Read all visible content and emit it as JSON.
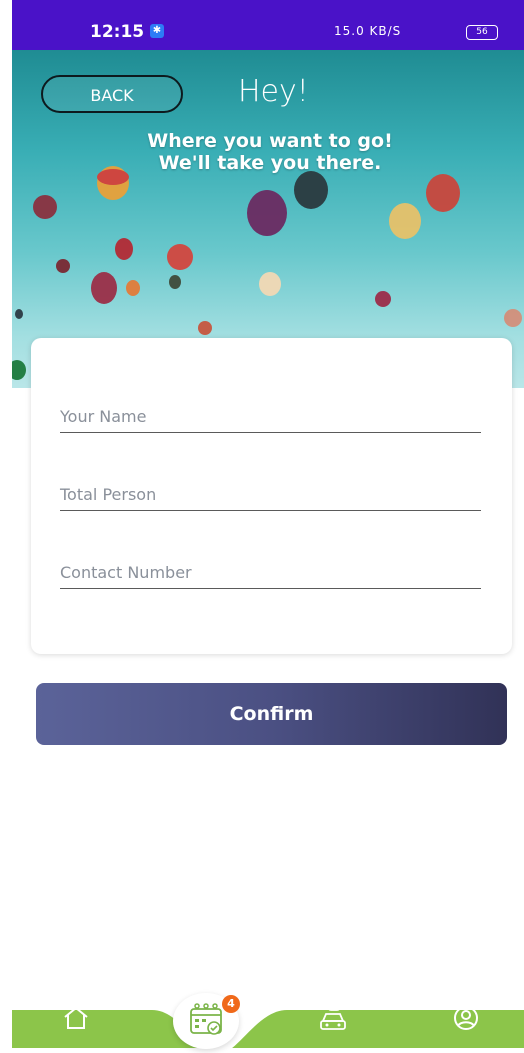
{
  "status_bar": {
    "time": "12:15",
    "bluetooth_badge": "✱",
    "network_speed": "15.0 KB/S",
    "battery": "56"
  },
  "header": {
    "back_label": "BACK",
    "greeting": "Hey!",
    "tagline_line1": "Where you want to go!",
    "tagline_line2": "We'll take you there."
  },
  "form": {
    "name_placeholder": "Your Name",
    "persons_placeholder": "Total Person",
    "contact_placeholder": "Contact Number"
  },
  "actions": {
    "confirm_label": "Confirm"
  },
  "bottom_nav": {
    "calendar_badge": "4",
    "items": [
      "home-icon",
      "calendar-icon",
      "car-icon",
      "profile-icon"
    ]
  },
  "colors": {
    "status_bar": "#4a12c8",
    "nav_green": "#8cc54a",
    "button_start": "#5b6399",
    "button_end": "#313257",
    "badge": "#f0691a"
  }
}
